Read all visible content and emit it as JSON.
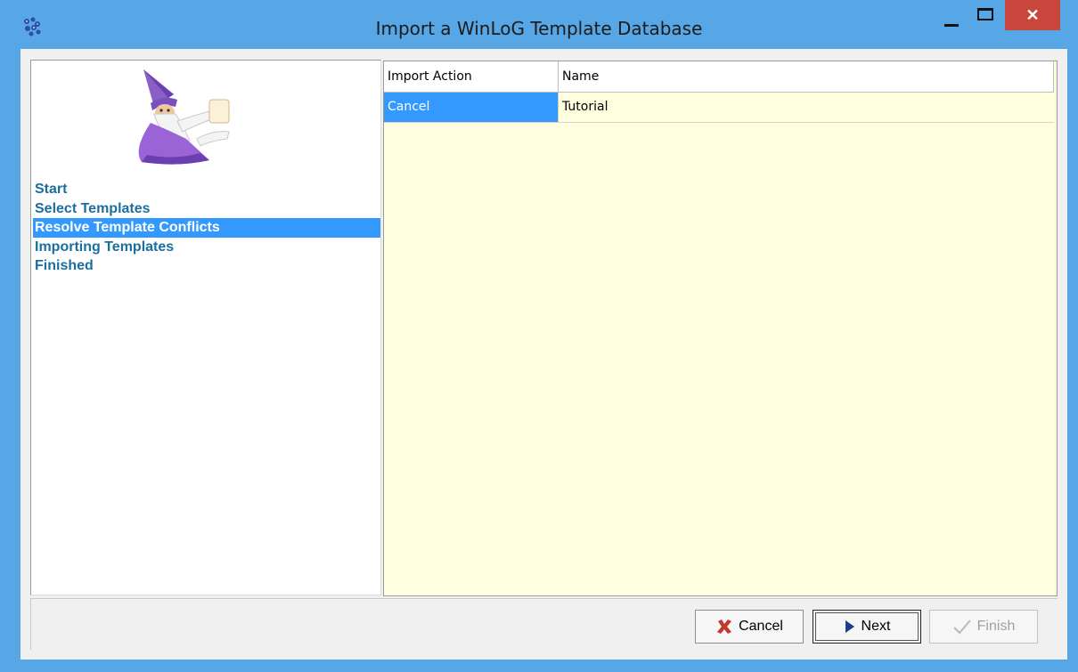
{
  "window": {
    "title": "Import a WinLoG Template Database",
    "close_glyph": "✕"
  },
  "steps": [
    {
      "label": "Start",
      "active": false
    },
    {
      "label": "Select Templates",
      "active": false
    },
    {
      "label": "Resolve Template Conflicts",
      "active": true
    },
    {
      "label": "Importing Templates",
      "active": false
    },
    {
      "label": "Finished",
      "active": false
    }
  ],
  "grid": {
    "columns": [
      "Import Action",
      "Name"
    ],
    "rows": [
      {
        "action": "Cancel",
        "name": "Tutorial"
      }
    ]
  },
  "buttons": {
    "cancel_label": "Cancel",
    "next_label": "Next",
    "finish_label": "Finish"
  },
  "icons": {
    "app": "app-gear-icon",
    "cancel": "red-x-icon",
    "next": "play-triangle-icon",
    "finish": "check-icon",
    "wizard": "wizard-image"
  },
  "colors": {
    "title_bar": "#57a7e6",
    "close_button": "#c8463c",
    "selection": "#3399ff",
    "grid_background": "#ffffe0",
    "step_text": "#1a6fa0"
  }
}
